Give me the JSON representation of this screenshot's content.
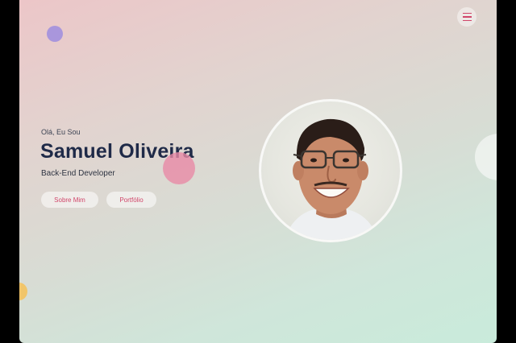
{
  "header": {
    "menu_icon": "hamburger-icon"
  },
  "hero": {
    "greeting": "Olá, Eu Sou",
    "name": "Samuel Oliveira",
    "role": "Back-End Developer",
    "buttons": {
      "about": "Sobre Mim",
      "portfolio": "Portfólio"
    }
  },
  "colors": {
    "accent": "#d0466a",
    "name_text": "#1f2a48",
    "gradient_top": "#ecc6c8",
    "gradient_bottom": "#c9ebdb"
  }
}
